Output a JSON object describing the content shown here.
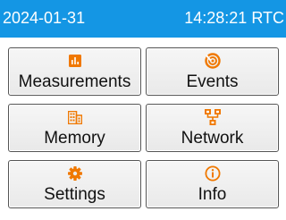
{
  "status_bar": {
    "date": "2024-01-31",
    "time": "14:28:21 RTC",
    "background_color": "#1496e4"
  },
  "accent_color": "#f07800",
  "menu": {
    "items": [
      {
        "label": "Measurements",
        "icon": "bar-chart-icon"
      },
      {
        "label": "Events",
        "icon": "events-swirl-icon"
      },
      {
        "label": "Memory",
        "icon": "memory-building-icon"
      },
      {
        "label": "Network",
        "icon": "network-icon"
      },
      {
        "label": "Settings",
        "icon": "gear-icon"
      },
      {
        "label": "Info",
        "icon": "info-icon"
      }
    ]
  }
}
